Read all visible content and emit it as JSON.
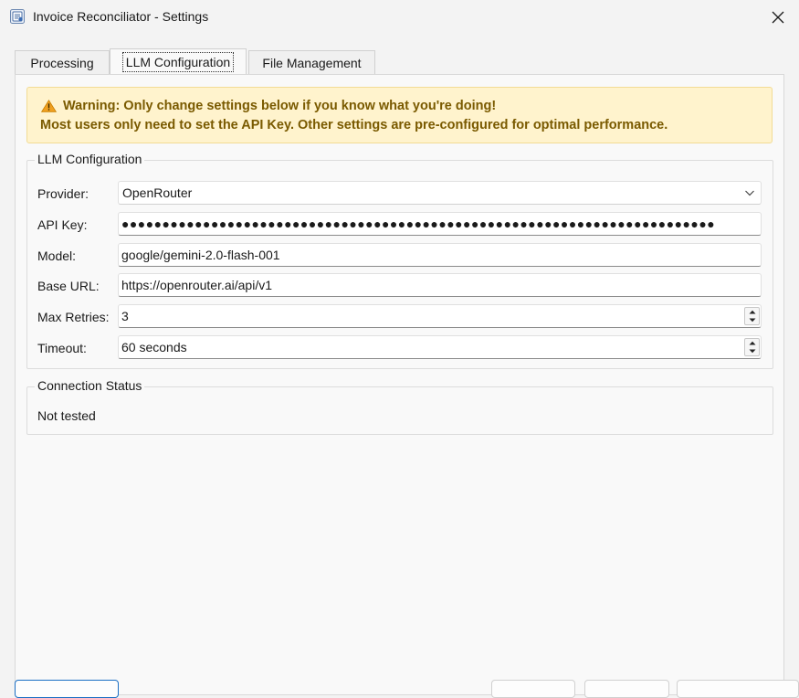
{
  "window": {
    "title": "Invoice Reconciliator - Settings"
  },
  "tabs": [
    {
      "label": "Processing",
      "active": false
    },
    {
      "label": "LLM Configuration",
      "active": true
    },
    {
      "label": "File Management",
      "active": false
    }
  ],
  "warning": {
    "icon": "warning-triangle-icon",
    "line1": "Warning: Only change settings below if you know what you're doing!",
    "line2": "Most users only need to set the API Key. Other settings are pre-configured for optimal performance.",
    "text_color": "#7a5a00",
    "background_color": "#fff3cd"
  },
  "llm_group": {
    "title": "LLM Configuration",
    "provider": {
      "label": "Provider:",
      "value": "OpenRouter"
    },
    "api_key": {
      "label": "API Key:",
      "value": "●●●●●●●●●●●●●●●●●●●●●●●●●●●●●●●●●●●●●●●●●●●●●●●●●●●●●●●●●●●●●●●●●●●●●●●●●"
    },
    "model": {
      "label": "Model:",
      "value": "google/gemini-2.0-flash-001"
    },
    "base_url": {
      "label": "Base URL:",
      "value": "https://openrouter.ai/api/v1"
    },
    "max_retries": {
      "label": "Max Retries:",
      "value": "3"
    },
    "timeout": {
      "label": "Timeout:",
      "value": "60 seconds"
    }
  },
  "connection_group": {
    "title": "Connection Status",
    "status": "Not tested"
  },
  "colors": {
    "accent": "#1a6fc4",
    "window_bg": "#f3f3f3",
    "panel_bg": "#f9f9f9"
  }
}
